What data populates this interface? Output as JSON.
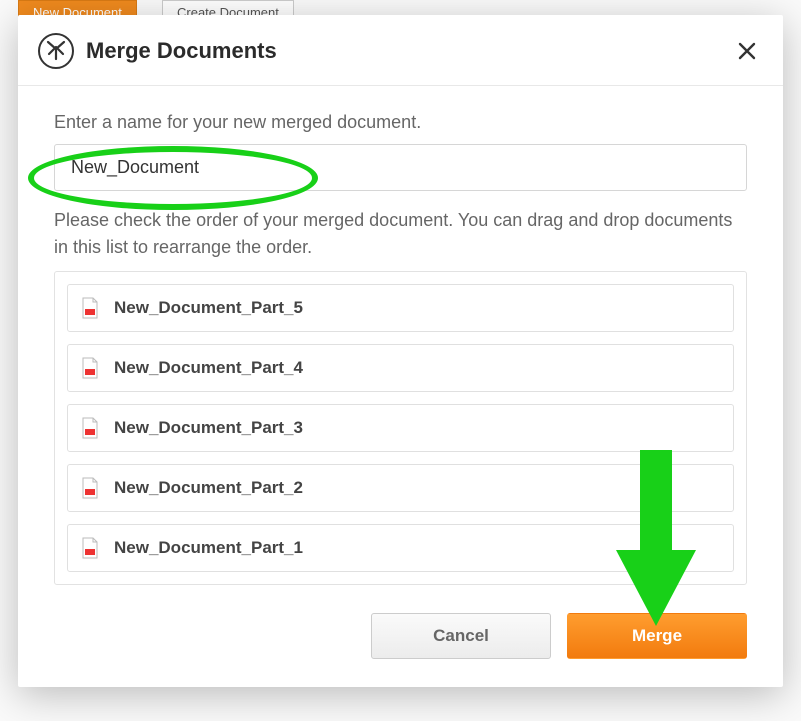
{
  "background": {
    "btn1": "New Document",
    "btn2": "Create Document"
  },
  "modal": {
    "title": "Merge Documents",
    "instruction_name": "Enter a name for your new merged document.",
    "name_value": "New_Document",
    "instruction_order": "Please check the order of your merged document. You can drag and drop documents in this list to rearrange the order.",
    "items": [
      "New_Document_Part_5",
      "New_Document_Part_4",
      "New_Document_Part_3",
      "New_Document_Part_2",
      "New_Document_Part_1"
    ],
    "cancel_label": "Cancel",
    "merge_label": "Merge"
  }
}
